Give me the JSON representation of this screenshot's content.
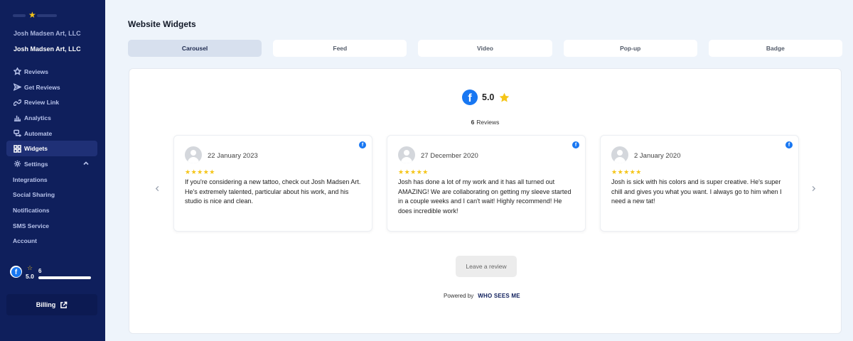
{
  "sidebar": {
    "org_secondary": "Josh Madsen Art, LLC",
    "org_primary": "Josh Madsen Art, LLC",
    "items": [
      {
        "label": "Reviews",
        "icon": "star-icon"
      },
      {
        "label": "Get Reviews",
        "icon": "send-icon"
      },
      {
        "label": "Review Link",
        "icon": "link-icon"
      },
      {
        "label": "Analytics",
        "icon": "bar-chart-icon"
      },
      {
        "label": "Automate",
        "icon": "automate-icon"
      },
      {
        "label": "Widgets",
        "icon": "widgets-icon",
        "active": true
      },
      {
        "label": "Settings",
        "icon": "gear-icon"
      },
      {
        "label": "Integrations"
      },
      {
        "label": "Social Sharing"
      },
      {
        "label": "Notifications"
      },
      {
        "label": "SMS Service"
      },
      {
        "label": "Account"
      }
    ],
    "rating": {
      "score": "5.0",
      "count": "6"
    },
    "billing_label": "Billing"
  },
  "main": {
    "title": "Website Widgets",
    "tabs": [
      {
        "label": "Carousel",
        "active": true
      },
      {
        "label": "Feed"
      },
      {
        "label": "Video"
      },
      {
        "label": "Pop-up"
      },
      {
        "label": "Badge"
      }
    ],
    "widget": {
      "score": "5.0",
      "reviews_count": "6",
      "reviews_label": "Reviews",
      "cards": [
        {
          "date": "22 January 2023",
          "stars": "★★★★★",
          "text": "If you're considering a new tattoo, check out Josh Madsen Art. He's extremely talented, particular about his work, and his studio is nice and clean."
        },
        {
          "date": "27 December 2020",
          "stars": "★★★★★",
          "text": "Josh has done a lot of my work and it has all turned out AMAZING! We are collaborating on getting my sleeve started in a couple weeks and I can't wait! Highly recommend! He does incredible work!"
        },
        {
          "date": "2 January 2020",
          "stars": "★★★★★",
          "text": "Josh is sick with his colors and is super creative. He's super chill and gives you what you want. I always go to him when I need a new tat!"
        }
      ],
      "leave_review_label": "Leave a review",
      "powered_by": "Powered by",
      "brand": "WHO SEES ME"
    }
  },
  "colors": {
    "sidebar_bg": "#0f1f5c",
    "facebook_blue": "#1877f2",
    "star_gold": "#f5c518",
    "page_bg": "#eef4fb"
  }
}
